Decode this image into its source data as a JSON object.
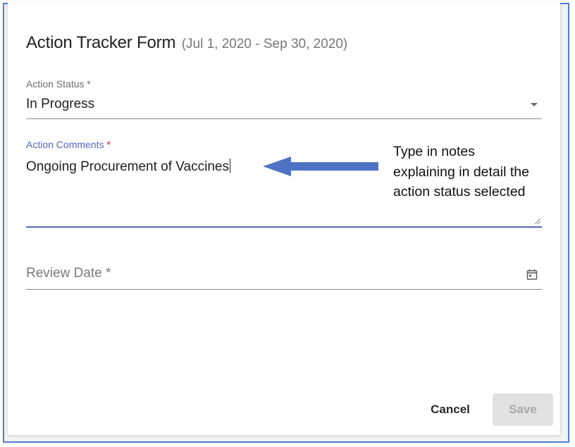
{
  "dialog": {
    "title": "Action Tracker Form",
    "date_range": "(Jul 1, 2020 - Sep 30, 2020)"
  },
  "action_status": {
    "label": "Action Status *",
    "value": "In Progress"
  },
  "action_comments": {
    "label": "Action Comments",
    "required_marker": "*",
    "value": "Ongoing Procurement of Vaccines"
  },
  "review_date": {
    "placeholder": "Review Date *",
    "icon": "calendar-icon"
  },
  "annotation": {
    "lines": [
      "Type in notes",
      "explaining in detail the",
      "action status selected"
    ]
  },
  "buttons": {
    "cancel": "Cancel",
    "save": "Save"
  },
  "colors": {
    "focus_accent": "#5467c2",
    "required_red": "#d0112b",
    "arrow": "#4f73c4",
    "frame_border": "#4a7fd0"
  }
}
